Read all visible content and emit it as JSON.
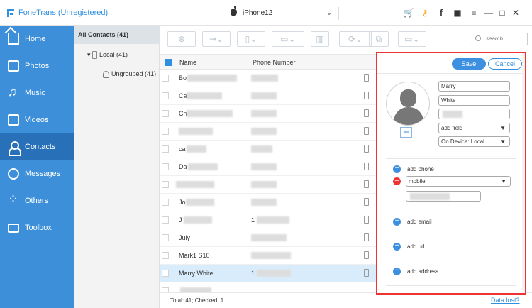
{
  "app": {
    "title": "FoneTrans (Unregistered)",
    "device": "iPhone12"
  },
  "sidebar": {
    "items": [
      {
        "label": "Home",
        "icon": "house"
      },
      {
        "label": "Photos",
        "icon": "image"
      },
      {
        "label": "Music",
        "icon": "music-note"
      },
      {
        "label": "Videos",
        "icon": "video"
      },
      {
        "label": "Contacts",
        "icon": "person"
      },
      {
        "label": "Messages",
        "icon": "chat"
      },
      {
        "label": "Others",
        "icon": "dots"
      },
      {
        "label": "Toolbox",
        "icon": "toolbox"
      }
    ],
    "active": "Contacts"
  },
  "tree": {
    "all_contacts": "All Contacts (41)",
    "local": "Local (41)",
    "ungrouped": "Ungrouped (41)"
  },
  "search": {
    "placeholder": "search"
  },
  "list": {
    "name_header": "Name",
    "phone_header": "Phone Number",
    "rows": [
      {
        "name": "Bo",
        "phone": ""
      },
      {
        "name": "Ca",
        "phone": ""
      },
      {
        "name": "Ch",
        "phone": ""
      },
      {
        "name": "",
        "phone": ""
      },
      {
        "name": "ca",
        "phone": ""
      },
      {
        "name": "Da",
        "phone": ""
      },
      {
        "name": "",
        "phone": ""
      },
      {
        "name": "Jo",
        "phone": ""
      },
      {
        "name": "J",
        "phone": "1"
      },
      {
        "name": "July",
        "phone": ""
      },
      {
        "name": "Mark1 S10",
        "phone": ""
      },
      {
        "name": "Marry White",
        "phone": "1"
      },
      {
        "name": "",
        "phone": ""
      }
    ]
  },
  "footer": {
    "status": "Total: 41; Checked: 1",
    "data_lost": "Data lost?"
  },
  "detail": {
    "save": "Save",
    "cancel": "Cancel",
    "first_name": "Marry",
    "last_name": "White",
    "add_field": "add field",
    "location": "On Device: Local",
    "add_phone": "add phone",
    "phone_type": "mobile",
    "add_email": "add email",
    "add_url": "add url",
    "add_address": "add address"
  }
}
